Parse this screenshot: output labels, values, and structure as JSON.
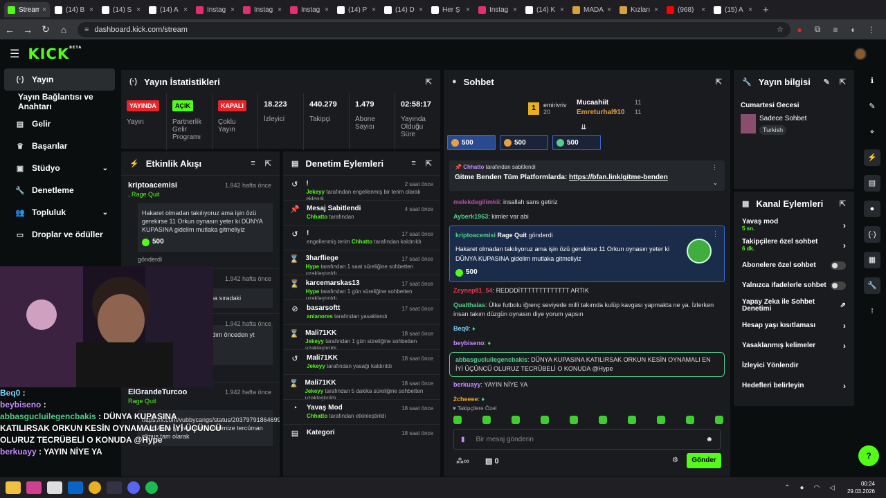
{
  "tabs": [
    {
      "label": "Stream",
      "color": "#53fc18",
      "active": true
    },
    {
      "label": "(14) B",
      "color": "#ffffff"
    },
    {
      "label": "(14) S",
      "color": "#ffffff"
    },
    {
      "label": "(14) A",
      "color": "#ffffff"
    },
    {
      "label": "Instag",
      "color": "#e1306c"
    },
    {
      "label": "Instag",
      "color": "#e1306c"
    },
    {
      "label": "Instag",
      "color": "#e1306c"
    },
    {
      "label": "(14) P",
      "color": "#ffffff"
    },
    {
      "label": "(14) D",
      "color": "#ffffff"
    },
    {
      "label": "Her Ş",
      "color": "#ffffff"
    },
    {
      "label": "Instag",
      "color": "#e1306c"
    },
    {
      "label": "(14) K",
      "color": "#ffffff"
    },
    {
      "label": "MADA",
      "color": "#d6a23a"
    },
    {
      "label": "Kızları",
      "color": "#d6a23a"
    },
    {
      "label": "(968)",
      "color": "#ff0000"
    },
    {
      "label": "(15) A",
      "color": "#ffffff"
    }
  ],
  "address": "dashboard.kick.com/stream",
  "brand": {
    "logo": "KICK",
    "beta": "BETA",
    "accent": "#53fc18"
  },
  "sidebar": [
    {
      "label": "Yayın",
      "icon": "stream-icon",
      "active": true
    },
    {
      "label": "Yayın Bağlantısı ve Anahtarı",
      "icon": ""
    },
    {
      "label": "Gelir",
      "icon": "revenue-icon"
    },
    {
      "label": "Başarılar",
      "icon": "trophy-icon"
    },
    {
      "label": "Stüdyo",
      "icon": "studio-icon",
      "chevron": true
    },
    {
      "label": "Denetleme",
      "icon": "wrench-icon"
    },
    {
      "label": "Topluluk",
      "icon": "community-icon",
      "chevron": true
    },
    {
      "label": "Droplar ve ödüller",
      "icon": "drops-icon"
    }
  ],
  "stats": {
    "title": "Yayın İstatistikleri",
    "items": [
      {
        "badge": "YAYINDA",
        "badge_bg": "#e5252a",
        "badge_fg": "#ffffff",
        "label": "Yayın"
      },
      {
        "badge": "AÇIK",
        "badge_bg": "#53fc18",
        "badge_fg": "#000000",
        "label": "Partnerlik Gelir Programı"
      },
      {
        "badge": "KAPALI",
        "badge_bg": "#e5252a",
        "badge_fg": "#ffffff",
        "label": "Çoklu Yayın"
      },
      {
        "value": "18.223",
        "label": "İzleyici"
      },
      {
        "value": "440.279",
        "label": "Takipçi"
      },
      {
        "value": "1.479",
        "label": "Abone Sayısı"
      },
      {
        "value": "02:58:17",
        "label": "Yayında Olduğu Süre"
      }
    ]
  },
  "activity": {
    "title": "Etkinlik Akışı",
    "items": [
      {
        "user": "kriptoacemisi",
        "time": "1.942 hafta önce",
        "sub": ", Rage Quit",
        "msg": "Hakaret olmadan takılıyoruz ama işin özü gerekirse 11 Orkun oynasın yeter ki DÜNYA KUPASINA gidelim mutlaka gitmeliyiz",
        "coins": "500",
        "note": "gönderdi"
      },
      {
        "user": "kriptoacemisi",
        "time": "1.942 hafta önce",
        "sub": "",
        "msg": "...eden oynamıyor ... acaba sıradaki",
        "coins": "",
        "note": ""
      },
      {
        "user": "",
        "time": "1.942 hafta önce",
        "sub": "",
        "msg": "...sabi yeni açtım ve ...şladım önceden yt ...ştan selamlar <3",
        "coins": "500",
        "note": "gönderdi"
      },
      {
        "user": "ElGrandeTurcoo",
        "time": "1.942 hafta önce",
        "sub": "Rage Quit",
        "msg": "https://x.com/vubbycangs/status/2037979186469979?s=46 Abim iyi yayınlar fikirlerimize tercüman olmuş tam olarak",
        "coins": "",
        "note": ""
      }
    ]
  },
  "moderation": {
    "title": "Denetim Eylemleri",
    "items": [
      {
        "title": "!",
        "icon": "undo-icon",
        "time": "2 saat önce",
        "pre": "",
        "hl": "Jekeyy",
        "post": " tarafından engellenmiş bir terim olarak eklendi"
      },
      {
        "title": "Mesaj Sabitlendi",
        "icon": "pin-icon",
        "time": "4 saat önce",
        "pre": "",
        "hl": "Chhatto",
        "post": " tarafından"
      },
      {
        "title": "!",
        "icon": "undo-icon",
        "time": "17 saat önce",
        "pre": "engellenmiş terim ",
        "hl": "Chhatto",
        "post": " tarafından kaldırıldı"
      },
      {
        "title": "3harfliege",
        "icon": "hourglass-icon",
        "time": "17 saat önce",
        "pre": "",
        "hl": "Hype",
        "post": " tarafından 1 saat süreliğine sohbetten uzaklaştırıldı"
      },
      {
        "title": "karcemarskas13",
        "icon": "hourglass-icon",
        "time": "17 saat önce",
        "pre": "",
        "hl": "Hype",
        "post": " tarafından 1 gün süreliğine sohbetten uzaklaştırıldı"
      },
      {
        "title": "basarsoftt",
        "icon": "ban-icon",
        "time": "17 saat önce",
        "pre": "",
        "hl": "anianores",
        "post": " tarafından yasaklandı"
      },
      {
        "title": "Mali71KK",
        "icon": "hourglass-icon",
        "time": "18 saat önce",
        "pre": "",
        "hl": "Jekeyy",
        "post": " tarafından 1 gün süreliğine sohbetten uzaklaştırıldı"
      },
      {
        "title": "Mali71KK",
        "icon": "undo-icon",
        "time": "18 saat önce",
        "pre": "",
        "hl": "Jekeyy",
        "post": " tarafından yasağı kaldırıldı"
      },
      {
        "title": "Mali71KK",
        "icon": "hourglass-icon",
        "time": "18 saat önce",
        "pre": "",
        "hl": "Jekeyy",
        "post": " tarafından 5 dakika süreliğine sohbetten uzaklaştırıldı"
      },
      {
        "title": "Yavaş Mod",
        "icon": "slow-icon",
        "time": "18 saat önce",
        "pre": "",
        "hl": "Chhatto",
        "post": " tarafından etkinleştirildi"
      },
      {
        "title": "Kategori",
        "icon": "category-icon",
        "time": "18 saat önce",
        "pre": "",
        "hl": "",
        "post": ""
      }
    ]
  },
  "chat": {
    "title": "Sohbet",
    "leaderboard": [
      {
        "rank": "1",
        "user": "emirivriv",
        "count": "20"
      },
      {
        "user": "Mucaahiit",
        "count": "11"
      },
      {
        "user": "Emreturhal910",
        "count": "11"
      }
    ],
    "kicks": [
      "500",
      "500",
      "500"
    ],
    "pinned": {
      "by": "Chhatto",
      "by_suffix": " tarafından sabitlendi",
      "text": "Gitme Benden Tüm Platformlarda: ",
      "link": "https://bfan.link/gitme-benden"
    },
    "messages": [
      {
        "user": "melekdegilimkii",
        "color": "#b84ea8",
        "text": "insallah sans getiriz"
      },
      {
        "user": "Ayberk1963",
        "color": "#4fd18b",
        "text": "kimler var abi"
      }
    ],
    "highlight": {
      "user": "kriptoacemisi",
      "title": "Rage Quit",
      "suffix": " gönderdi",
      "text": "Hakaret olmadan takılıyoruz ama işin özü gerekirse 11 Orkun oynasın yeter ki DÜNYA KUPASINA gidelim mutlaka gitmeliyiz",
      "coins": "500"
    },
    "messages2": [
      {
        "user": "Zeynep81_54",
        "color": "#e5374f",
        "text": "REDDDİTTTTTTTTTTTTT ARTIK"
      },
      {
        "user": "Qualthalas",
        "color": "#4fd18b",
        "text": "Ülke futbolu iğrenç seviyede milli takımda kulüp kavgası yapmakta ne ya. İzlerken insan takım düzgün oynasın diye yorum yapsın"
      },
      {
        "user": "Beq0",
        "color": "#7dd3fc",
        "text": ""
      },
      {
        "user": "beybiseno",
        "color": "#c68cff",
        "text": ""
      }
    ],
    "mention": {
      "user": "abbasgucluilegencbakis",
      "text": "DÜNYA KUPASINA KATILIRSAK ORKUN KESİN OYNAMALI EN İYİ ÜÇÜNCÜ OLURUZ TECRÜBELİ O KONUDA @Hype"
    },
    "messages3": [
      {
        "user": "berkuayy",
        "color": "#c68cff",
        "text": "YAYIN NİYE YA"
      },
      {
        "user": "2cheeee",
        "color": "#f5a623",
        "text": ""
      }
    ],
    "followers_only": "Takipçilere Özel",
    "placeholder": "Bir mesaj gönderin",
    "count": "0",
    "send": "Gönder"
  },
  "info": {
    "title": "Yayın bilgisi",
    "stream_title": "Cumartesi Gecesi",
    "category": "Sadece Sohbet",
    "tag": "Turkish"
  },
  "channel": {
    "title": "Kanal Eylemleri",
    "rows": [
      {
        "label": "Yavaş mod",
        "sub": "5 sn.",
        "type": "chevron"
      },
      {
        "label": "Takipçilere özel sohbet",
        "sub": "6 dk.",
        "type": "chevron"
      },
      {
        "label": "Abonelere özel sohbet",
        "sub": "",
        "type": "toggle"
      },
      {
        "label": "Yalnızca ifadelerle sohbet",
        "sub": "",
        "type": "toggle"
      },
      {
        "label": "Yapay Zeka ile Sohbet Denetimi",
        "sub": "",
        "type": "external"
      },
      {
        "label": "Hesap yaşı kısıtlaması",
        "sub": "",
        "type": "chevron"
      },
      {
        "label": "Yasaklanmış kelimeler",
        "sub": "",
        "type": "chevron"
      },
      {
        "label": "İzleyici Yönlendir",
        "sub": "",
        "type": "none"
      },
      {
        "label": "Hedefleri belirleyin",
        "sub": "",
        "type": "chevron"
      }
    ]
  },
  "overlay": [
    {
      "user": "Beq0",
      "color": "#7dd3fc",
      "text": " :"
    },
    {
      "user": "beybiseno",
      "color": "#c68cff",
      "text": " :"
    },
    {
      "user": "abbasgucluilegencbakis",
      "color": "#4fd18b",
      "text": " : DÜNYA KUPASINA KATILIRSAK ORKUN KESİN OYNAMALI EN İYİ ÜÇÜNCÜ OLURUZ TECRÜBELİ O KONUDA @Hype"
    },
    {
      "user": "berkuayy",
      "color": "#c68cff",
      "text": " : YAYIN NİYE YA"
    }
  ],
  "clock": {
    "time": "00:24",
    "date": "29.03.2026"
  }
}
